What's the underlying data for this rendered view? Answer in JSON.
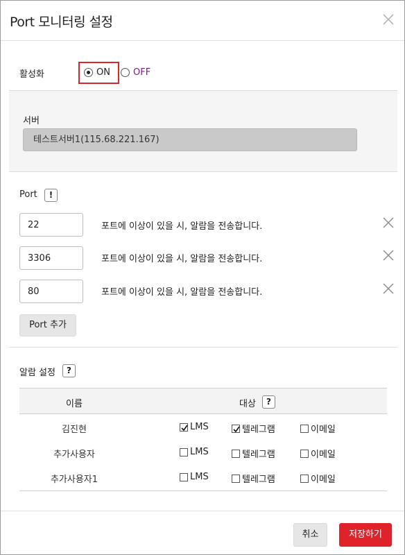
{
  "dialog": {
    "title": "Port 모니터링 설정"
  },
  "activation": {
    "label": "활성화",
    "on_label": "ON",
    "off_label": "OFF",
    "selected": "ON"
  },
  "server": {
    "label": "서버",
    "value": "테스트서버1(115.68.221.167)"
  },
  "port": {
    "label": "Port",
    "info_glyph": "!",
    "rows": [
      {
        "value": "22",
        "desc": "포트에 이상이 있을 시, 알람을 전송합니다."
      },
      {
        "value": "3306",
        "desc": "포트에 이상이 있을 시, 알람을 전송합니다."
      },
      {
        "value": "80",
        "desc": "포트에 이상이 있을 시, 알람을 전송합니다."
      }
    ],
    "add_label": "Port 추가"
  },
  "alarm": {
    "label": "알람 설정",
    "info_glyph": "?",
    "col_name": "이름",
    "col_target": "대상",
    "target_info_glyph": "?",
    "rows": [
      {
        "name": "김진현",
        "lms": true,
        "telegram": true,
        "email": false
      },
      {
        "name": "추가사용자",
        "lms": false,
        "telegram": false,
        "email": false
      },
      {
        "name": "추가사용자1",
        "lms": false,
        "telegram": false,
        "email": false
      }
    ],
    "lms_label": "LMS",
    "telegram_label": "텔레그램",
    "email_label": "이메일"
  },
  "footer": {
    "cancel_label": "취소",
    "save_label": "저장하기"
  },
  "icons": {
    "close": "close-icon",
    "remove": "remove-icon",
    "check": "checkmark-icon"
  },
  "colors": {
    "accent": "#e0232b",
    "off_text": "#7a1a8a",
    "panel_bg": "#f5f5f5"
  }
}
